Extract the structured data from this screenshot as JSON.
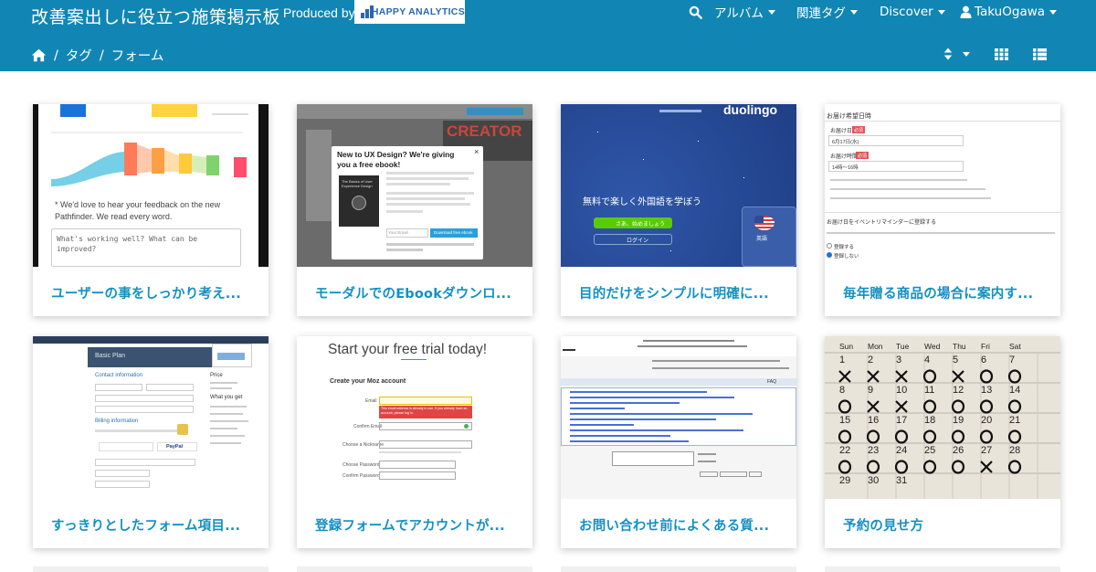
{
  "header": {
    "site_title": "改善案出しに役立つ施策掲示板",
    "produced_by": "Produced by",
    "logo_text": "HAPPY ANALYTICS",
    "nav": {
      "album": "アルバム",
      "related_tags": "関連タグ",
      "discover": "Discover",
      "user": "TakuOgawa"
    },
    "breadcrumb": {
      "tag": "タグ",
      "current": "フォーム"
    }
  },
  "colors": {
    "header_bg": "#1186b4",
    "title_text": "#1490c3",
    "logo_blue": "#2b67b1"
  },
  "icons": {
    "search": "search-icon",
    "user": "user-icon",
    "home": "home-icon",
    "sort": "sort-icon",
    "grid_view": "grid-view-icon",
    "list_view": "list-view-icon"
  },
  "cards": [
    {
      "title": "ユーザーの事をしっかり考え...",
      "thumb": {
        "feedback": "* We'd love to hear your feedback on the new Pathfinder. We read every word.",
        "placeholder": "What's working well? What can be improved?"
      }
    },
    {
      "title": "モーダルでのEbookダウンロ...",
      "thumb": {
        "modal_title": "New to UX Design? We're giving you a free ebook!",
        "book": "The Basics of User Experience Design",
        "button": "Download free ebook",
        "email_placeholder": "Your Email",
        "brand": "CREATOR"
      }
    },
    {
      "title": "目的だけをシンプルに明確に...",
      "thumb": {
        "brand": "duolingo",
        "headline": "無料で楽しく外国語を学ぼう",
        "start_button": "さあ、始めましょう",
        "login_button": "ログイン",
        "lang": "英語"
      }
    },
    {
      "title": "毎年贈る商品の場合に案内す...",
      "thumb": {
        "heading": "お届け希望日時",
        "date_label": "お届け日",
        "date_value": "6月17日(水)",
        "time_label": "お届け時間",
        "time_value": "14時〜16時",
        "badge": "必須",
        "reminder": "お届け日をイベントリマインダーに登録する",
        "opt_yes": "登録する",
        "opt_no": "登録しない"
      }
    },
    {
      "title": "すっきりとしたフォーム項目...",
      "thumb": {
        "plan": "Basic Plan",
        "contact": "Contact information",
        "billing": "Billing information",
        "price": "Price",
        "what_you_get": "What you get",
        "paypal": "PayPal"
      }
    },
    {
      "title": "登録フォームでアカウントが...",
      "thumb": {
        "headline": "Start your free trial today!",
        "section": "Create your Moz account",
        "email_label": "Email",
        "confirm_label": "Confirm Email",
        "nickname_label": "Choose a Nickname",
        "password_label": "Choose Password",
        "confirm_password_label": "Confirm Password",
        "error": "This email address is already in use. If you already have an account, please log in."
      }
    },
    {
      "title": "お問い合わせ前によくある質...",
      "thumb": {
        "faq": "FAQ"
      }
    },
    {
      "title": "予約の見せ方",
      "thumb": {
        "days": [
          "Sun",
          "Mon",
          "Tue",
          "Wed",
          "Thu",
          "Fri",
          "Sat"
        ],
        "weeks": [
          [
            "1",
            "2",
            "3",
            "4",
            "5",
            "6",
            "7"
          ],
          [
            "8",
            "9",
            "10",
            "11",
            "12",
            "13",
            "14"
          ],
          [
            "15",
            "16",
            "17",
            "18",
            "19",
            "20",
            "21"
          ],
          [
            "22",
            "23",
            "24",
            "25",
            "26",
            "27",
            "28"
          ],
          [
            "29",
            "30",
            "31",
            "",
            "",
            "",
            ""
          ]
        ],
        "marks": [
          [
            "",
            "",
            "",
            "",
            "",
            "",
            ""
          ],
          [
            "x",
            "x",
            "x",
            "o",
            "x",
            "o",
            "o"
          ],
          [
            "o",
            "x",
            "x",
            "o",
            "o",
            "o",
            "o"
          ],
          [
            "o",
            "o",
            "o",
            "o",
            "o",
            "o",
            "o"
          ],
          [
            "o",
            "o",
            "o",
            "o",
            "o",
            "x",
            "o"
          ]
        ]
      }
    }
  ]
}
